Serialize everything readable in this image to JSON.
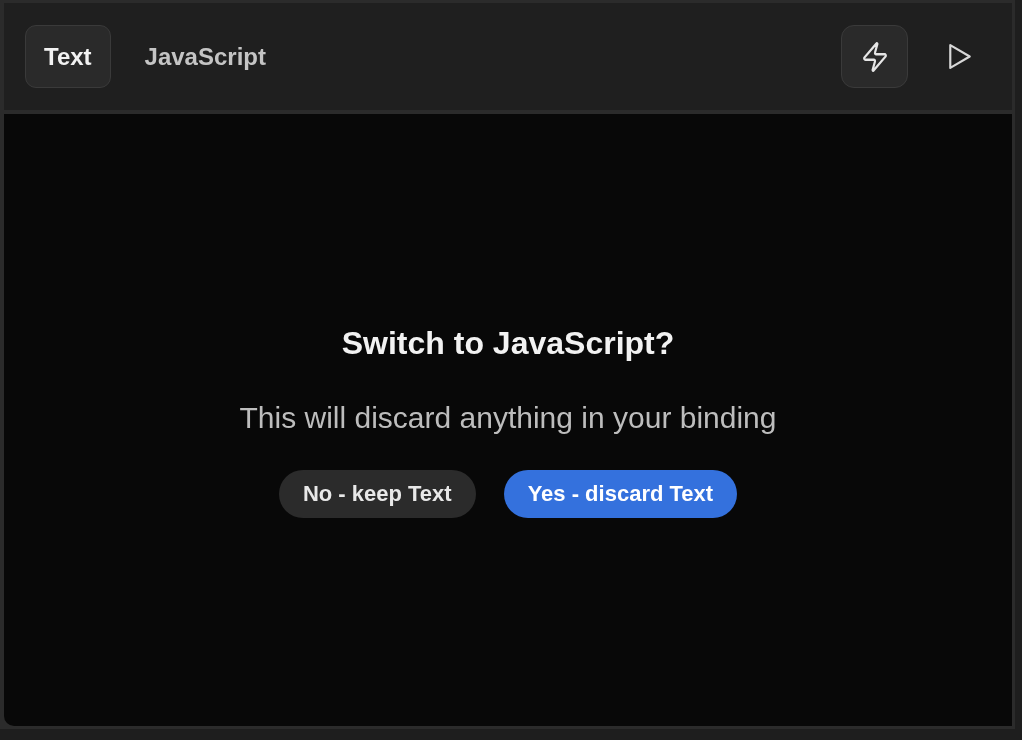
{
  "tabs": [
    {
      "label": "Text",
      "selected": true
    },
    {
      "label": "JavaScript",
      "selected": false
    }
  ],
  "actions": [
    {
      "kind": "lightning",
      "active": true
    },
    {
      "kind": "play",
      "active": false
    }
  ],
  "dialog": {
    "title": "Switch to JavaScript?",
    "message": "This will discard anything in your binding",
    "buttons": [
      {
        "label": "No - keep Text",
        "kind": "secondary"
      },
      {
        "label": "Yes - discard Text",
        "kind": "primary"
      }
    ]
  }
}
